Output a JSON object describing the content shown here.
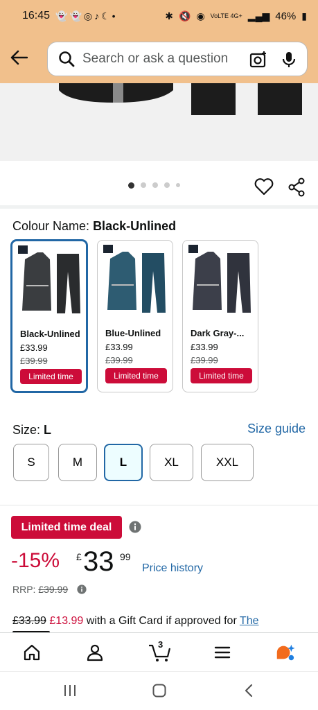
{
  "status_bar": {
    "time": "16:45",
    "left_icons": "👻👻◎♪☾•",
    "network": "VoLTE 4G+",
    "battery": "46%"
  },
  "search": {
    "placeholder": "Search or ask a question"
  },
  "carousel": {
    "dot_count": 5,
    "active_index": 0
  },
  "colour": {
    "label": "Colour Name:",
    "selected_value": "Black-Unlined",
    "options": [
      {
        "name": "Black-Unlined",
        "price": "£33.99",
        "rrp": "£39.99",
        "badge": "Limited time",
        "color": "#3a3d40"
      },
      {
        "name": "Blue-Unlined",
        "price": "£33.99",
        "rrp": "£39.99",
        "badge": "Limited time",
        "color": "#2e5c72"
      },
      {
        "name": "Dark Gray-...",
        "price": "£33.99",
        "rrp": "£39.99",
        "badge": "Limited time",
        "color": "#3c3f4a"
      }
    ]
  },
  "size": {
    "label": "Size:",
    "selected_value": "L",
    "guide_label": "Size guide",
    "options": [
      "S",
      "M",
      "L",
      "XL",
      "XXL"
    ]
  },
  "deal": {
    "badge": "Limited time deal",
    "discount": "-15%",
    "currency": "£",
    "price_whole": "33",
    "price_fraction": "99",
    "price_history": "Price history",
    "rrp_label": "RRP:",
    "rrp_value": "£39.99"
  },
  "gift": {
    "old_price": "£33.99",
    "new_price": "£13.99",
    "text": "with a Gift Card if approved for",
    "link": "The"
  },
  "bottom_nav": {
    "cart_count": "3"
  },
  "colors": {
    "header_bg": "#f1c08c",
    "accent_blue": "#2167a5",
    "deal_red": "#cc0c39"
  }
}
